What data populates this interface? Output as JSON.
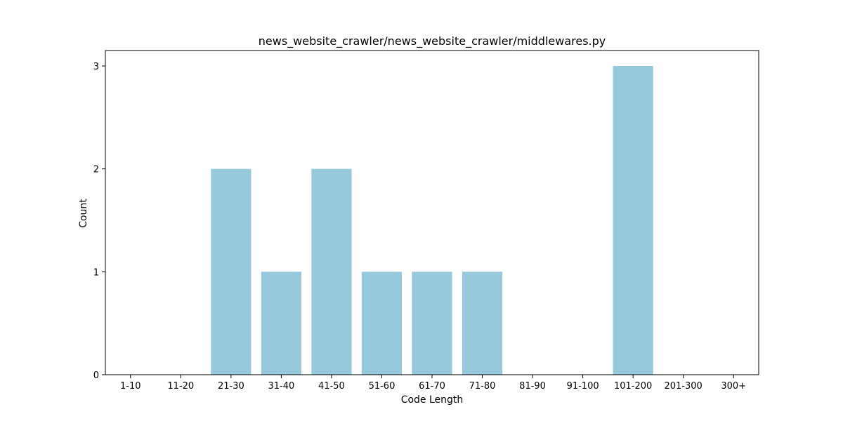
{
  "chart_data": {
    "type": "bar",
    "title": "news_website_crawler/news_website_crawler/middlewares.py",
    "xlabel": "Code Length",
    "ylabel": "Count",
    "categories": [
      "1-10",
      "11-20",
      "21-30",
      "31-40",
      "41-50",
      "51-60",
      "61-70",
      "71-80",
      "81-90",
      "91-100",
      "101-200",
      "201-300",
      "300+"
    ],
    "values": [
      0,
      0,
      2,
      1,
      2,
      1,
      1,
      1,
      0,
      0,
      3,
      0,
      0
    ],
    "yticks": [
      0,
      1,
      2,
      3
    ],
    "ylim": [
      0,
      3.15
    ],
    "grid": false,
    "bar_color": "#96c9dc"
  }
}
